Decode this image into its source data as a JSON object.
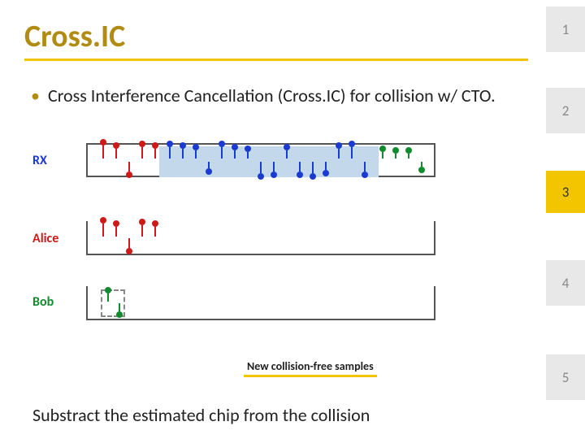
{
  "title": "Cross.IC",
  "bullet": "Cross Interference Cancellation (Cross.IC) for collision w/ CTO.",
  "labels": {
    "rx": "RX",
    "alice": "Alice",
    "bob": "Bob"
  },
  "caption": "New collision-free samples",
  "footer": "Substract the estimated chip from the collision",
  "tabs": {
    "t1": "1",
    "t2": "2",
    "t3": "3",
    "t4": "4",
    "t5": "5"
  }
}
